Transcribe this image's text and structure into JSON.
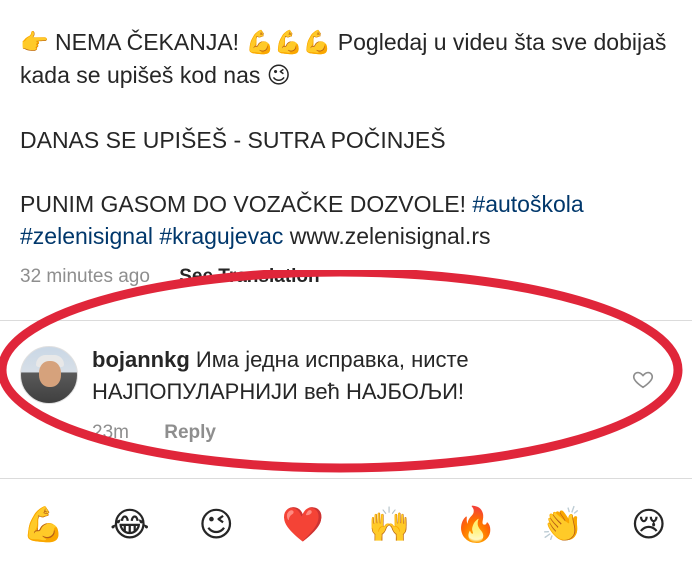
{
  "caption": {
    "line1_lead_emoji": "👉",
    "line1_text_a": "NEMA ČEKANJA!",
    "line1_emojis": "💪💪💪",
    "line1_text_b": "Pogledaj u videu šta sve dobijaš kada se upišeš kod nas",
    "line1_trailing_emoji": "😉",
    "line2": "DANAS SE UPIŠEŠ - SUTRA POČINJEŠ",
    "line3_text": "PUNIM GASOM DO VOZAČKE DOZVOLE!",
    "hashtags": [
      "#autoškola",
      "#zelenisignal",
      "#kragujevac"
    ],
    "link": "www.zelenisignal.rs"
  },
  "post_meta": {
    "time": "32 minutes ago",
    "see_translation": "See Translation"
  },
  "comment": {
    "username": "bojannkg",
    "text": "Има једна исправка, нисте НАЈПОПУЛАРНИЈИ већ НАЈБОЉИ!",
    "time": "23m",
    "reply_label": "Reply",
    "like_icon": "heart-outline-icon"
  },
  "annotation": {
    "shape": "ellipse",
    "color": "#e0263a"
  },
  "emoji_bar": {
    "items": [
      "💪",
      "😂",
      "😉",
      "❤️",
      "🙌",
      "🔥",
      "👏",
      "😢"
    ]
  }
}
